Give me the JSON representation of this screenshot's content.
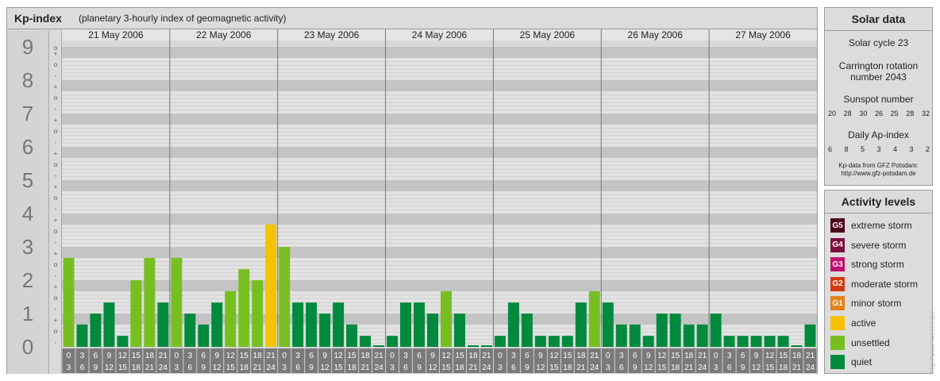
{
  "header": {
    "title": "Kp-index",
    "subtitle": "(planetary 3-hourly index of geomagnetic activity)"
  },
  "chart_data": {
    "type": "bar",
    "title": "Kp-index",
    "subtitle": "(planetary 3-hourly index of geomagnetic activity)",
    "ylim": [
      0,
      9
    ],
    "y_ticks": [
      "0",
      "1",
      "2",
      "3",
      "4",
      "5",
      "6",
      "7",
      "8",
      "9"
    ],
    "sub_ticks": [
      "-",
      "o",
      "+"
    ],
    "days": [
      "21 May 2006",
      "22 May 2006",
      "23 May 2006",
      "24 May 2006",
      "25 May 2006",
      "26 May 2006",
      "27 May 2006"
    ],
    "interval_labels": [
      [
        "0",
        "3"
      ],
      [
        "3",
        "6"
      ],
      [
        "6",
        "9"
      ],
      [
        "9",
        "12"
      ],
      [
        "12",
        "15"
      ],
      [
        "15",
        "18"
      ],
      [
        "18",
        "21"
      ],
      [
        "21",
        "24"
      ]
    ],
    "values": [
      [
        2.67,
        0.67,
        1.0,
        1.33,
        0.33,
        2.0,
        2.67,
        1.33
      ],
      [
        2.67,
        1.0,
        0.67,
        1.33,
        1.67,
        2.33,
        2.0,
        3.67
      ],
      [
        3.0,
        1.33,
        1.33,
        1.0,
        1.33,
        0.67,
        0.33,
        0.0
      ],
      [
        0.33,
        1.33,
        1.33,
        1.0,
        1.67,
        1.0,
        0.0,
        0.0
      ],
      [
        0.33,
        1.33,
        1.0,
        0.33,
        0.33,
        0.33,
        1.33,
        1.67
      ],
      [
        1.33,
        0.67,
        0.67,
        0.33,
        1.0,
        1.0,
        0.67,
        0.67
      ],
      [
        1.0,
        0.33,
        0.33,
        0.33,
        0.33,
        0.33,
        0.0,
        0.67
      ]
    ],
    "colors": {
      "quiet": "#008a3e",
      "unsettled": "#77bf21",
      "active": "#f5c200"
    },
    "grid": true,
    "legend": "right"
  },
  "solar": {
    "title": "Solar data",
    "cycle": "Solar cycle 23",
    "carrington_1": "Carrington rotation",
    "carrington_2": "number 2043",
    "sunspot_label": "Sunspot number",
    "sunspot_values": [
      "20",
      "28",
      "30",
      "26",
      "25",
      "28",
      "32"
    ],
    "ap_label": "Daily Ap-index",
    "ap_values": [
      "6",
      "8",
      "5",
      "3",
      "4",
      "3",
      "2"
    ],
    "source_1": "Kp-data from GFZ Potsdam:",
    "source_2": "http://www.gfz-potsdam.de"
  },
  "levels": {
    "title": "Activity levels",
    "items": [
      {
        "code": "G5",
        "label": "extreme storm",
        "color": "#4a0018"
      },
      {
        "code": "G4",
        "label": "severe storm",
        "color": "#7a1040"
      },
      {
        "code": "G3",
        "label": "strong storm",
        "color": "#c0106e"
      },
      {
        "code": "G2",
        "label": "moderate storm",
        "color": "#d23a10"
      },
      {
        "code": "G1",
        "label": "minor storm",
        "color": "#e4821a"
      },
      {
        "code": "",
        "label": "active",
        "color": "#f5c200"
      },
      {
        "code": "",
        "label": "unsettled",
        "color": "#77bf21"
      },
      {
        "code": "",
        "label": "quiet",
        "color": "#008a3e"
      }
    ]
  },
  "watermark": "http://www.tweeter.de/..."
}
